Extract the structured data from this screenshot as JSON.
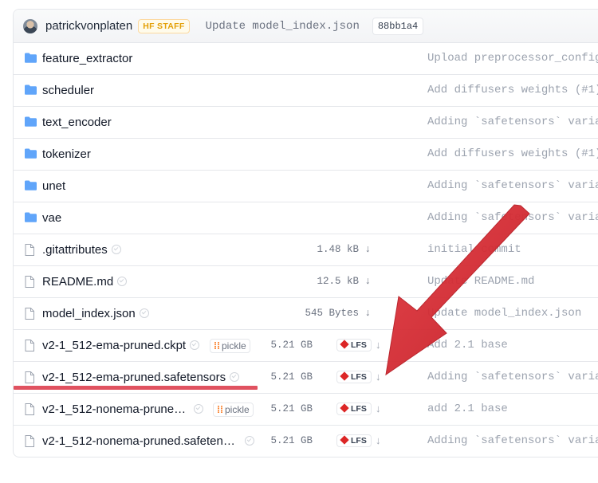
{
  "header": {
    "author": "patrickvonplaten",
    "staff_badge": "HF STAFF",
    "commit_message": "Update model_index.json",
    "commit_hash": "88bb1a4"
  },
  "icons": {
    "folder": "folder-icon",
    "file": "file-icon",
    "download": "download-icon"
  },
  "colors": {
    "folder": "#60a5fa",
    "lfs": "#dc2626",
    "pickle": "#f97316",
    "annotation": "#d8262f"
  },
  "folders": [
    {
      "name": "feature_extractor",
      "message": "Upload preprocessor_config"
    },
    {
      "name": "scheduler",
      "message": "Add diffusers weights (#1)"
    },
    {
      "name": "text_encoder",
      "message": "Adding `safetensors` varia"
    },
    {
      "name": "tokenizer",
      "message": "Add diffusers weights (#1)"
    },
    {
      "name": "unet",
      "message": "Adding `safetensors` varia"
    },
    {
      "name": "vae",
      "message": "Adding `safetensors` varia"
    }
  ],
  "files": [
    {
      "name": ".gitattributes",
      "size": "1.48 kB",
      "lfs": "",
      "pickle": "",
      "message": "initial commit"
    },
    {
      "name": "README.md",
      "size": "12.5 kB",
      "lfs": "",
      "pickle": "",
      "message": "Update README.md"
    },
    {
      "name": "model_index.json",
      "size": "545 Bytes",
      "lfs": "",
      "pickle": "",
      "message": "Update model_index.json"
    },
    {
      "name": "v2-1_512-ema-pruned.ckpt",
      "size": "5.21 GB",
      "lfs": "LFS",
      "pickle": "pickle",
      "message": "Add 2.1 base"
    },
    {
      "name": "v2-1_512-ema-pruned.safetensors",
      "size": "5.21 GB",
      "lfs": "LFS",
      "pickle": "",
      "message": "Adding `safetensors` varia"
    },
    {
      "name": "v2-1_512-nonema-prune…",
      "size": "5.21 GB",
      "lfs": "LFS",
      "pickle": "pickle",
      "message": "add 2.1 base"
    },
    {
      "name": "v2-1_512-nonema-pruned.safeten…",
      "size": "5.21 GB",
      "lfs": "LFS",
      "pickle": "",
      "message": "Adding `safetensors` varia"
    }
  ]
}
